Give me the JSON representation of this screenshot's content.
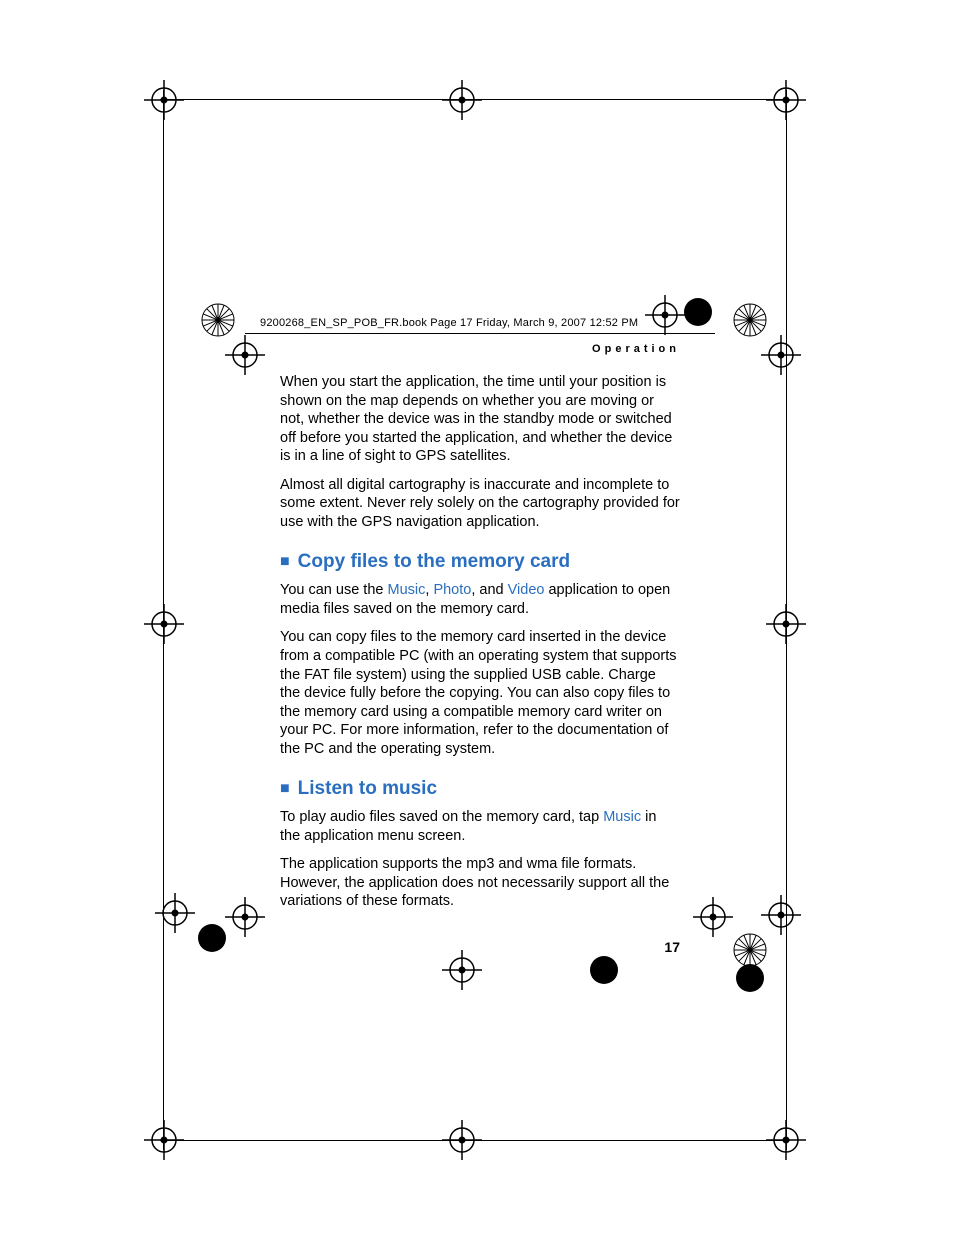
{
  "header": {
    "filename_line": "9200268_EN_SP_POB_FR.book  Page 17  Friday, March 9, 2007  12:52 PM"
  },
  "section_label": "Operation",
  "paragraphs": {
    "p1": "When you start the application, the time until your position is shown on the map depends on whether you are moving or not, whether the device was in the standby mode or switched off before you started the application, and whether the device is in a line of sight to GPS satellites.",
    "p2": "Almost all digital cartography is inaccurate and incomplete to some extent. Never rely solely on the cartography provided for use with the GPS navigation application."
  },
  "section1": {
    "title": "Copy files to the memory card",
    "p1_pre": "You can use the ",
    "p1_link1": "Music",
    "p1_mid1": ", ",
    "p1_link2": "Photo",
    "p1_mid2": ", and ",
    "p1_link3": "Video",
    "p1_post": " application to open media files saved on the memory card.",
    "p2": "You can copy files to the memory card inserted in the device from a compatible PC (with an operating system that supports the FAT file system) using the supplied USB cable. Charge the device fully before the copying. You can also copy files to the memory card using a compatible memory card writer on your PC. For more information, refer to the documentation of the PC and the operating system."
  },
  "section2": {
    "title": "Listen to music",
    "p1_pre": "To play audio files saved on the memory card, tap ",
    "p1_link1": "Music",
    "p1_post": " in the application menu screen.",
    "p2": "The application supports the mp3 and wma file formats. However, the application does not necessarily support all the variations of these formats."
  },
  "page_number": "17"
}
